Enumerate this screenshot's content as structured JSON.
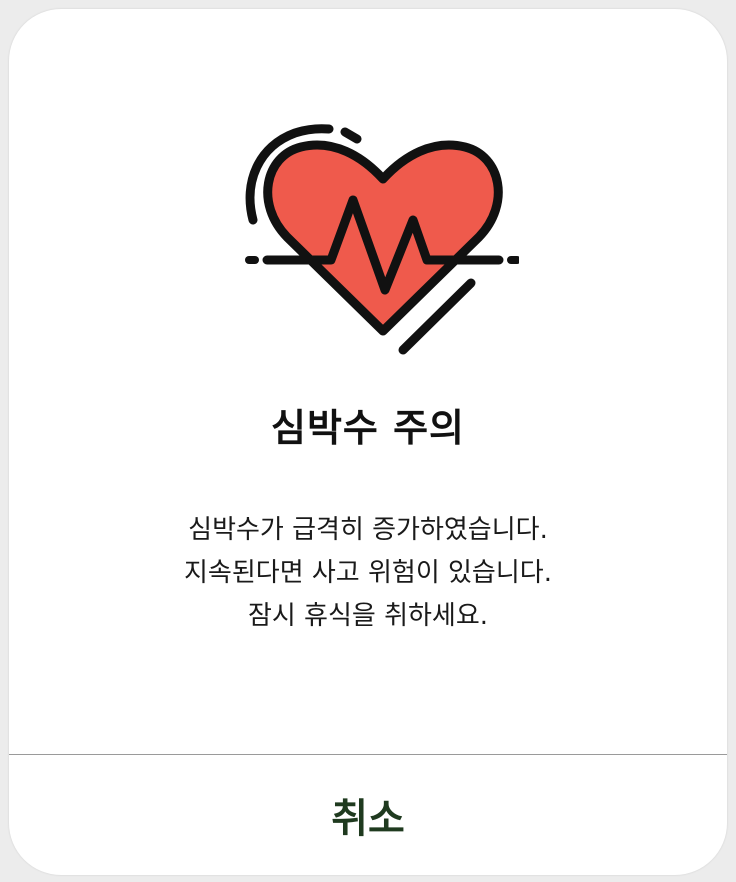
{
  "dialog": {
    "icon": "heart-rate-icon",
    "title": "심박수 주의",
    "message_lines": [
      "심박수가 급격히 증가하였습니다.",
      "지속된다면 사고 위험이 있습니다.",
      "잠시 휴식을 취하세요."
    ],
    "cancel_label": "취소"
  },
  "colors": {
    "heart_fill": "#ef5a4c",
    "outline": "#111111",
    "cancel_text": "#1f3a1f",
    "divider": "#9a9a9a"
  }
}
